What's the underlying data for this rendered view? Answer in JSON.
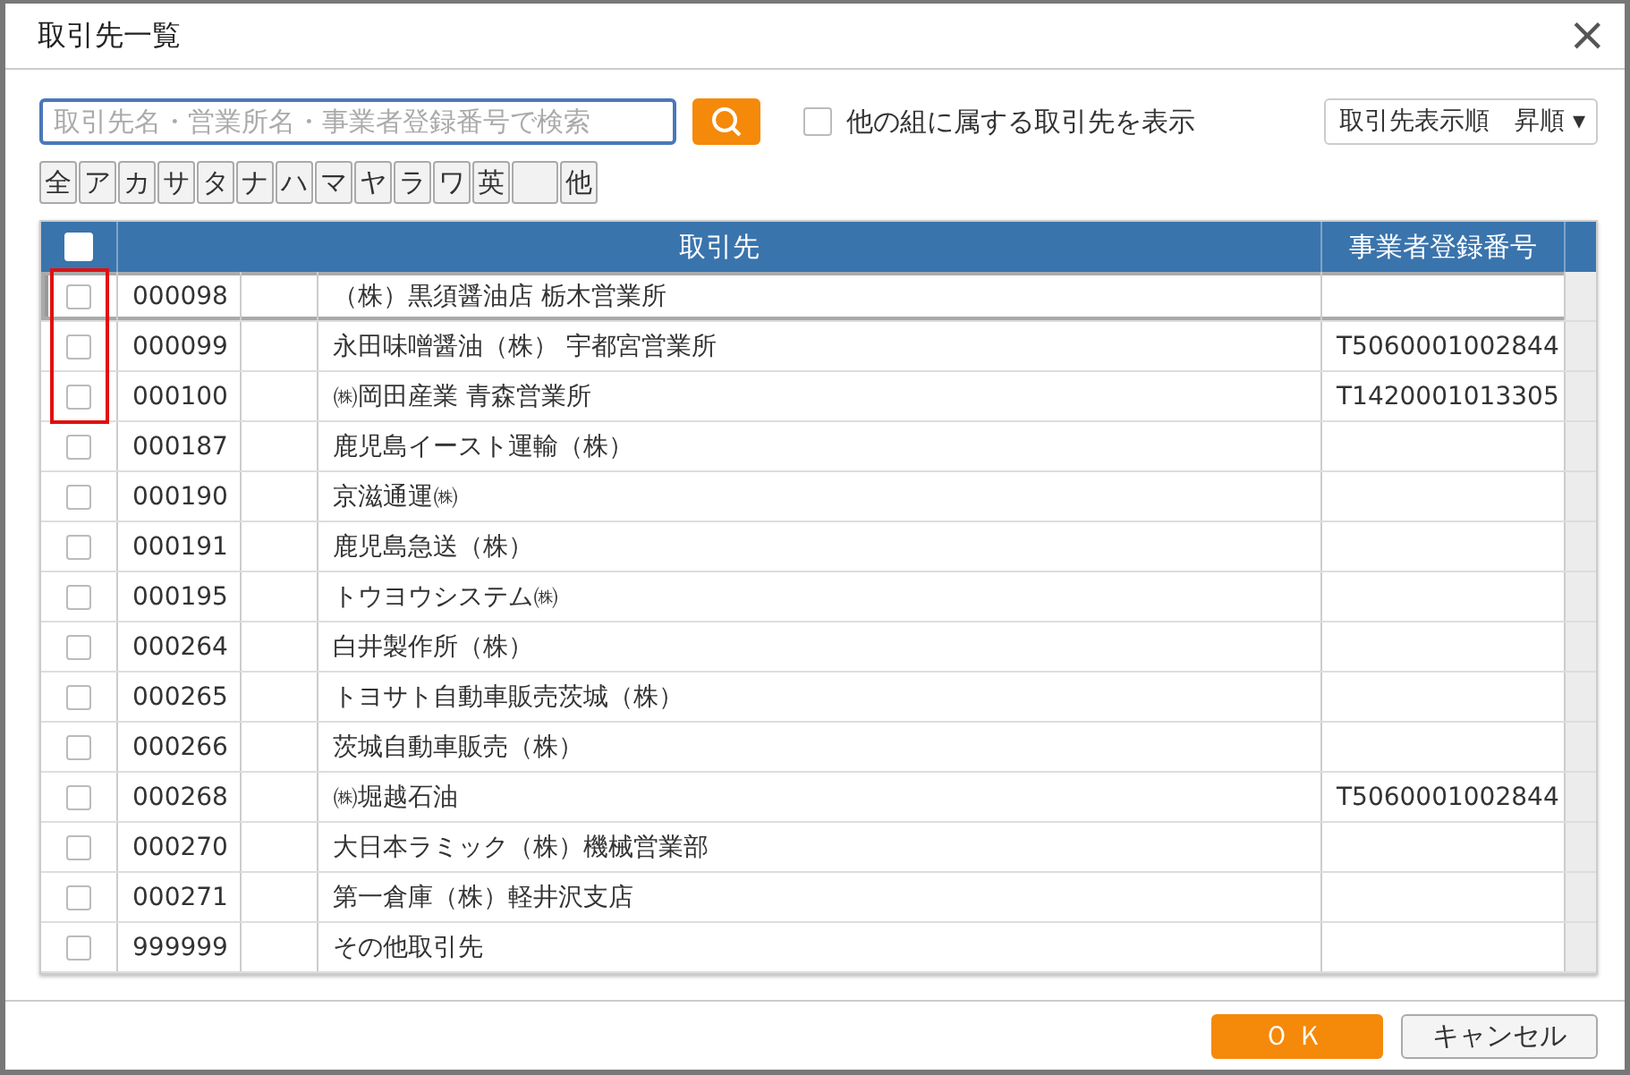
{
  "window": {
    "title": "取引先一覧",
    "close": "×"
  },
  "search": {
    "placeholder": "取引先名・営業所名・事業者登録番号で検索"
  },
  "show_other_groups": {
    "label": "他の組に属する取引先を表示",
    "checked": false
  },
  "sort": {
    "value": "取引先表示順　昇順",
    "caret": "▾"
  },
  "kana_buttons": [
    {
      "kind": "label",
      "label": "全"
    },
    {
      "kind": "label",
      "label": "ア"
    },
    {
      "kind": "label",
      "label": "カ"
    },
    {
      "kind": "label",
      "label": "サ"
    },
    {
      "kind": "label",
      "label": "タ"
    },
    {
      "kind": "label",
      "label": "ナ"
    },
    {
      "kind": "label",
      "label": "ハ"
    },
    {
      "kind": "label",
      "label": "マ"
    },
    {
      "kind": "label",
      "label": "ヤ"
    },
    {
      "kind": "label",
      "label": "ラ"
    },
    {
      "kind": "label",
      "label": "ワ"
    },
    {
      "kind": "label",
      "label": "英"
    },
    {
      "kind": "blank"
    },
    {
      "kind": "label",
      "label": "他"
    }
  ],
  "table": {
    "select_all_checked": false,
    "columns": [
      "取引先",
      "事業者登録番号"
    ],
    "rows": [
      {
        "checked": false,
        "selected": true,
        "highlighted": true,
        "code": "000098",
        "name": "（株）黒須醤油店 栃木営業所"
      },
      {
        "checked": false,
        "selected": false,
        "highlighted": true,
        "code": "000099",
        "name": "永田味噌醤油（株） 宇都宮営業所",
        "registration": "T5060001002844"
      },
      {
        "checked": false,
        "selected": false,
        "highlighted": true,
        "code": "000100",
        "name": "㈱岡田産業 青森営業所",
        "registration": "T1420001013305"
      },
      {
        "checked": false,
        "selected": false,
        "highlighted": false,
        "code": "000187",
        "name": "鹿児島イースト運輸（株）"
      },
      {
        "checked": false,
        "selected": false,
        "highlighted": false,
        "code": "000190",
        "name": "京滋通運㈱"
      },
      {
        "checked": false,
        "selected": false,
        "highlighted": false,
        "code": "000191",
        "name": "鹿児島急送（株）"
      },
      {
        "checked": false,
        "selected": false,
        "highlighted": false,
        "code": "000195",
        "name": "トウヨウシステム㈱"
      },
      {
        "checked": false,
        "selected": false,
        "highlighted": false,
        "code": "000264",
        "name": "白井製作所（株）"
      },
      {
        "checked": false,
        "selected": false,
        "highlighted": false,
        "code": "000265",
        "name": "トヨサト自動車販売茨城（株）"
      },
      {
        "checked": false,
        "selected": false,
        "highlighted": false,
        "code": "000266",
        "name": "茨城自動車販売（株）"
      },
      {
        "checked": false,
        "selected": false,
        "highlighted": false,
        "code": "000268",
        "name": "㈱堀越石油",
        "registration": "T5060001002844"
      },
      {
        "checked": false,
        "selected": false,
        "highlighted": false,
        "code": "000270",
        "name": "大日本ラミック（株）機械営業部"
      },
      {
        "checked": false,
        "selected": false,
        "highlighted": false,
        "code": "000271",
        "name": "第一倉庫（株）軽井沢支店"
      },
      {
        "checked": false,
        "selected": false,
        "highlighted": false,
        "code": "999999",
        "name": "その他取引先"
      }
    ]
  },
  "buttons": {
    "ok": "ＯＫ",
    "cancel": "キャンセル"
  }
}
